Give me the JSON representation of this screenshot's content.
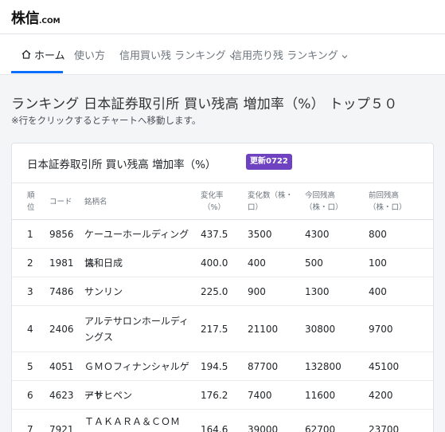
{
  "brand": {
    "name": "株信",
    "domain": ".COM"
  },
  "nav": {
    "home": "ホーム",
    "howto": "使い方",
    "margin_buy": "信用買い残 ランキング",
    "margin_sell": "信用売り残 ランキング"
  },
  "page": {
    "title": "ランキング 日本証券取引所 買い残高 増加率（%） トップ５０",
    "note": "※行をクリックするとチャートへ移動します。"
  },
  "card": {
    "title": "日本証券取引所 買い残高 増加率（%）",
    "badge": "更新0722"
  },
  "table": {
    "headers": {
      "rank_1": "順",
      "rank_2": "位",
      "code": "コード",
      "name": "銘柄名",
      "rate_1": "変化率",
      "rate_2": "（%）",
      "change_1": "変化数（株・",
      "change_2": "口）",
      "current_1": "今回残高",
      "current_2": "（株・口）",
      "previous_1": "前回残高",
      "previous_2": "（株・口）"
    },
    "rows": [
      {
        "rank": "1",
        "code": "9856",
        "name": "ケーユーホールディングス",
        "rate": "437.5",
        "change": "3500",
        "current": "4300",
        "previous": "800"
      },
      {
        "rank": "2",
        "code": "1981",
        "name": "協和日成",
        "rate": "400.0",
        "change": "400",
        "current": "500",
        "previous": "100"
      },
      {
        "rank": "3",
        "code": "7486",
        "name": "サンリン",
        "rate": "225.0",
        "change": "900",
        "current": "1300",
        "previous": "400"
      },
      {
        "rank": "4",
        "code": "2406",
        "name": "アルテサロンホールディングス",
        "rate": "217.5",
        "change": "21100",
        "current": "30800",
        "previous": "9700"
      },
      {
        "rank": "5",
        "code": "4051",
        "name": "ＧＭＯフィナンシャルゲート",
        "rate": "194.5",
        "change": "87700",
        "current": "132800",
        "previous": "45100"
      },
      {
        "rank": "6",
        "code": "4623",
        "name": "アサヒペン",
        "rate": "176.2",
        "change": "7400",
        "current": "11600",
        "previous": "4200"
      },
      {
        "rank": "7",
        "code": "7921",
        "name": "ＴＡＫＡＲＡ＆ＣＯＭ",
        "rate": "164.6",
        "change": "39000",
        "current": "62700",
        "previous": "23700"
      }
    ]
  }
}
